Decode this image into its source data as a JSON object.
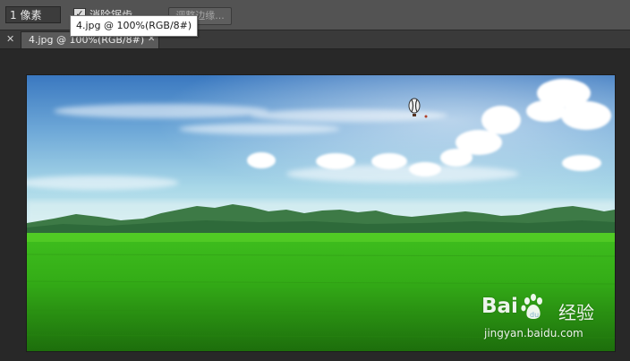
{
  "options_bar": {
    "size_value": "1 像素",
    "smooth_checked": true,
    "smooth_label": "消除锯齿",
    "refine_edge_label": "调整边缘..."
  },
  "tooltip": {
    "text": "4.jpg @ 100%(RGB/8#)"
  },
  "tab_bar": {
    "panel_close_icon": "close-icon",
    "tabs": [
      {
        "label": "4.jpg @ 100%(RGB/8#)",
        "close_icon": "close-icon",
        "active": true
      }
    ]
  },
  "canvas": {
    "image_description_icon": "landscape-photo",
    "colors": {
      "sky_top": "#3f7fc6",
      "sky_bottom": "#bfe6ec",
      "grass": "#48c41c"
    }
  },
  "watermark": {
    "logo_text_left": "Bai",
    "logo_text_right": "",
    "brand": "经验",
    "url": "jingyan.baidu.com"
  }
}
